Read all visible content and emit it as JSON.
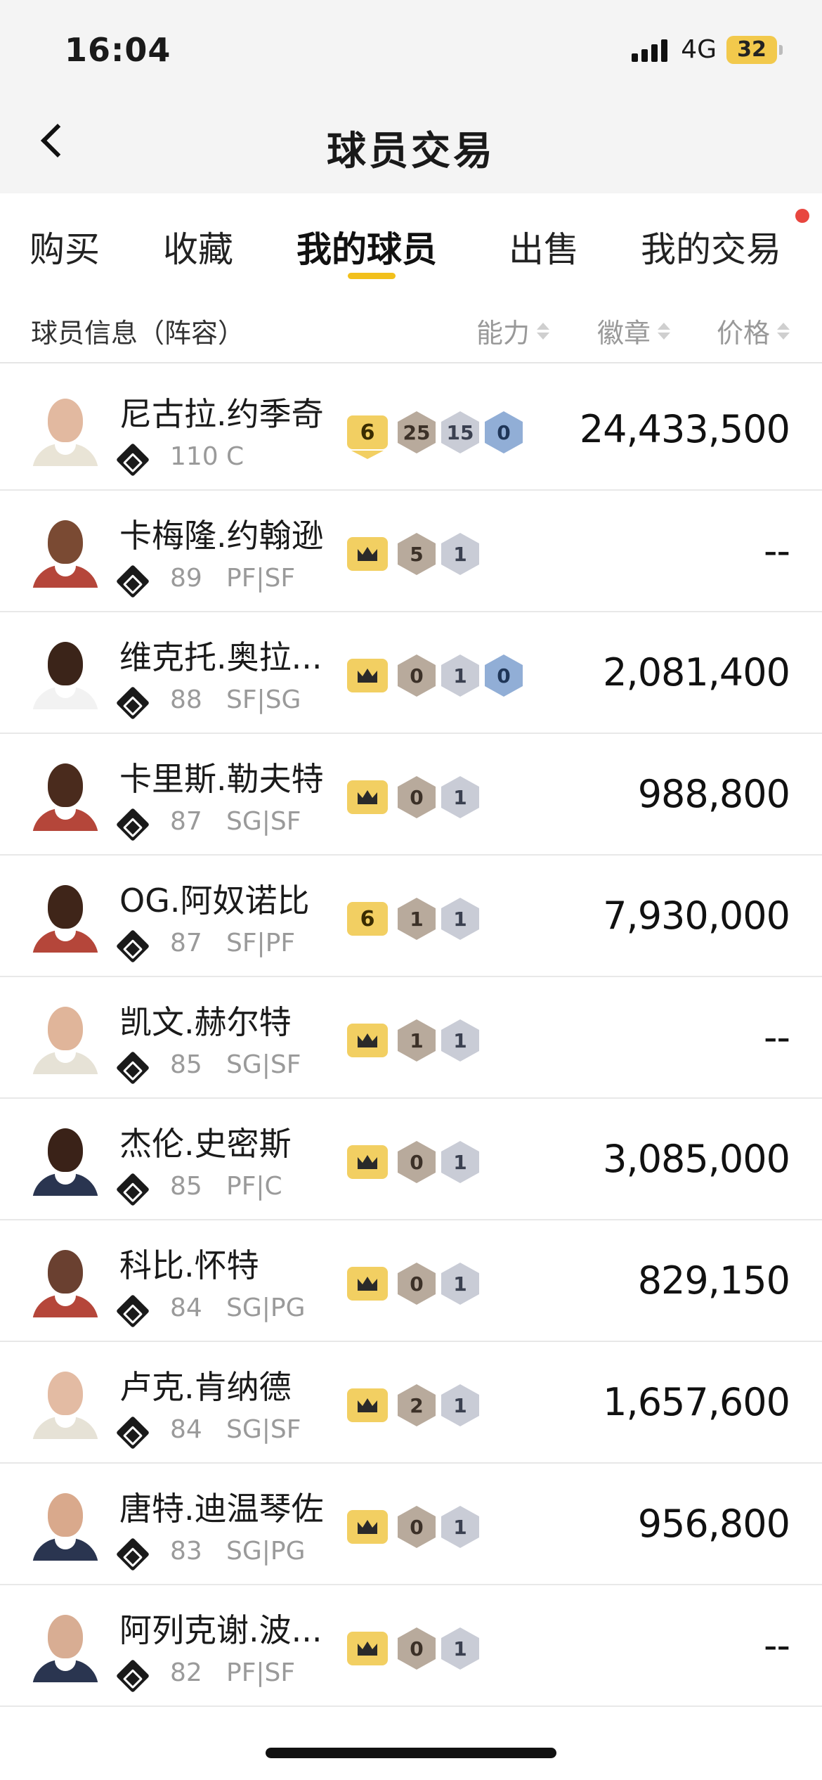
{
  "status_bar": {
    "time": "16:04",
    "network": "4G",
    "battery": "32"
  },
  "nav": {
    "title": "球员交易"
  },
  "tabs": [
    {
      "label": "购买",
      "active": false
    },
    {
      "label": "收藏",
      "active": false
    },
    {
      "label": "我的球员",
      "active": true
    },
    {
      "label": "出售",
      "active": false
    },
    {
      "label": "我的交易",
      "active": false
    }
  ],
  "columns": {
    "info": "球员信息（阵容）",
    "ability": "能力",
    "badges": "徽章",
    "price": "价格"
  },
  "players": [
    {
      "name": "尼古拉.约季奇",
      "rating": "110",
      "position": "C",
      "tier": "6",
      "badges": [
        "25",
        "15",
        "0"
      ],
      "price": "24,433,500",
      "skin": "#e2b9a0",
      "jersey": "#e9e4d6"
    },
    {
      "name": "卡梅隆.约翰逊",
      "rating": "89",
      "position": "PF|SF",
      "tier": "crown",
      "badges": [
        "5",
        "1"
      ],
      "price": "--",
      "skin": "#7a4a33",
      "jersey": "#b5463a"
    },
    {
      "name": "维克托.奥拉...",
      "rating": "88",
      "position": "SF|SG",
      "tier": "crown",
      "badges": [
        "0",
        "1",
        "0"
      ],
      "price": "2,081,400",
      "skin": "#3b2419",
      "jersey": "#f2f2f2"
    },
    {
      "name": "卡里斯.勒夫特",
      "rating": "87",
      "position": "SG|SF",
      "tier": "crown",
      "badges": [
        "0",
        "1"
      ],
      "price": "988,800",
      "skin": "#4a2b1d",
      "jersey": "#b5463a"
    },
    {
      "name": "OG.阿奴诺比",
      "rating": "87",
      "position": "SF|PF",
      "tier": "6",
      "badges": [
        "1",
        "1"
      ],
      "price": "7,930,000",
      "skin": "#3f2519",
      "jersey": "#b5463a"
    },
    {
      "name": "凯文.赫尔特",
      "rating": "85",
      "position": "SG|SF",
      "tier": "crown",
      "badges": [
        "1",
        "1"
      ],
      "price": "--",
      "skin": "#e0b59a",
      "jersey": "#e6e2d6"
    },
    {
      "name": "杰伦.史密斯",
      "rating": "85",
      "position": "PF|C",
      "tier": "crown",
      "badges": [
        "0",
        "1"
      ],
      "price": "3,085,000",
      "skin": "#3a2218",
      "jersey": "#2a3550"
    },
    {
      "name": "科比.怀特",
      "rating": "84",
      "position": "SG|PG",
      "tier": "crown",
      "badges": [
        "0",
        "1"
      ],
      "price": "829,150",
      "skin": "#6a4030",
      "jersey": "#b5463a"
    },
    {
      "name": "卢克.肯纳德",
      "rating": "84",
      "position": "SG|SF",
      "tier": "crown",
      "badges": [
        "2",
        "1"
      ],
      "price": "1,657,600",
      "skin": "#e3bba3",
      "jersey": "#e6e2d6"
    },
    {
      "name": "唐特.迪温琴佐",
      "rating": "83",
      "position": "SG|PG",
      "tier": "crown",
      "badges": [
        "0",
        "1"
      ],
      "price": "956,800",
      "skin": "#d9a98c",
      "jersey": "#2a3550"
    },
    {
      "name": "阿列克谢.波...",
      "rating": "82",
      "position": "PF|SF",
      "tier": "crown",
      "badges": [
        "0",
        "1"
      ],
      "price": "--",
      "skin": "#d8ad93",
      "jersey": "#2a3550"
    }
  ],
  "colors": {
    "accent": "#f2c01c",
    "notification": "#e8463f"
  }
}
